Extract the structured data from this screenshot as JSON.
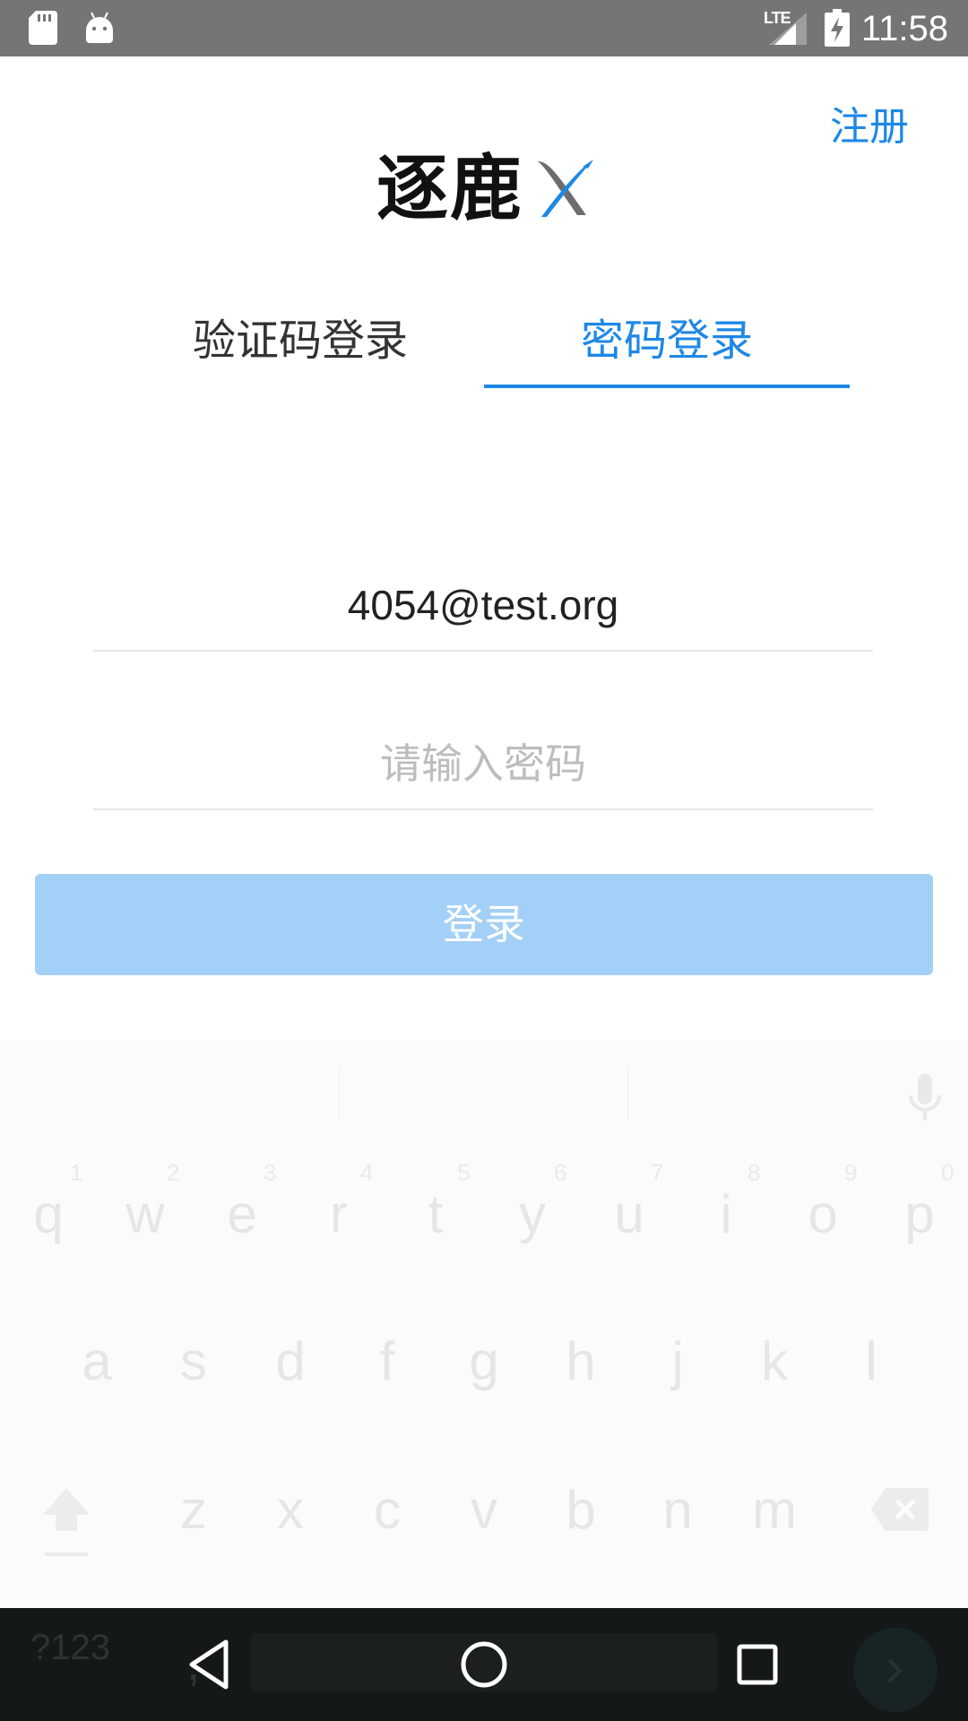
{
  "status_bar": {
    "time": "11:58",
    "network": "LTE",
    "icons": [
      "sd-card-icon",
      "android-icon",
      "signal-icon",
      "battery-charging-icon"
    ]
  },
  "header": {
    "register_label": "注册",
    "logo_text": "逐鹿",
    "logo_mark": "X"
  },
  "tabs": [
    {
      "label": "验证码登录",
      "active": false
    },
    {
      "label": "密码登录",
      "active": true
    }
  ],
  "form": {
    "email_value": "4054@test.org",
    "password_placeholder": "请输入密码",
    "login_label": "登录"
  },
  "colors": {
    "accent": "#1e88e5",
    "button_disabled": "#a3d0f6",
    "status_bar": "#757575",
    "nav_bar": "#151818"
  },
  "keyboard": {
    "row1": [
      "q",
      "w",
      "e",
      "r",
      "t",
      "y",
      "u",
      "i",
      "o",
      "p"
    ],
    "row1_numbers": [
      "1",
      "2",
      "3",
      "4",
      "5",
      "6",
      "7",
      "8",
      "9",
      "0"
    ],
    "row2": [
      "a",
      "s",
      "d",
      "f",
      "g",
      "h",
      "j",
      "k",
      "l"
    ],
    "row3": [
      "z",
      "x",
      "c",
      "v",
      "b",
      "n",
      "m"
    ],
    "symbols_label": "?123",
    "comma_label": ","
  }
}
